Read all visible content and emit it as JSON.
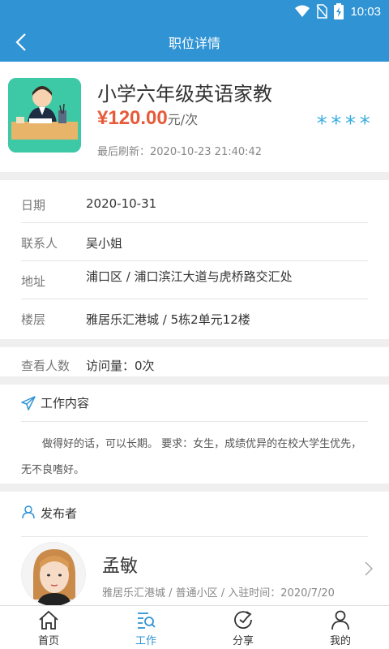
{
  "status_bar": {
    "time": "10:03"
  },
  "nav": {
    "title": "职位详情",
    "back_icon": "chevron-left-icon"
  },
  "job": {
    "title": "小学六年级英语家教",
    "price": "¥120.00",
    "price_unit": "元/次",
    "stars": "****",
    "refresh": "最后刷新：2020-10-23 21:40:42",
    "image_colors": {
      "bg": "#3dc9a6",
      "desk": "#e8b46a"
    }
  },
  "info": [
    {
      "label": "日期",
      "value": "2020-10-31"
    },
    {
      "label": "联系人",
      "value": "吴小姐"
    },
    {
      "label": "地址",
      "value": "浦口区 / 浦口滨江大道与虎桥路交汇处"
    },
    {
      "label": "楼层",
      "value": "雅居乐汇港城 / 5栋2单元12楼"
    }
  ],
  "views": {
    "label": "查看人数",
    "value": "访问量：0次"
  },
  "content": {
    "title": "工作内容",
    "text": "做得好的话，可以长期。 要求：女生，成绩优异的在校大学生优先，无不良嗜好。"
  },
  "publisher": {
    "section_title": "发布者",
    "name": "孟敏",
    "desc": "雅居乐汇港城 / 普通小区 / 入驻时间：2020/7/20"
  },
  "tabs": [
    {
      "label": "首页",
      "icon": "home-icon",
      "active": false
    },
    {
      "label": "工作",
      "icon": "work-search-icon",
      "active": true
    },
    {
      "label": "分享",
      "icon": "share-icon",
      "active": false
    },
    {
      "label": "我的",
      "icon": "user-icon",
      "active": false
    }
  ],
  "colors": {
    "primary": "#2f93d4",
    "price": "#e75a3a",
    "stars": "#3aaee0"
  }
}
